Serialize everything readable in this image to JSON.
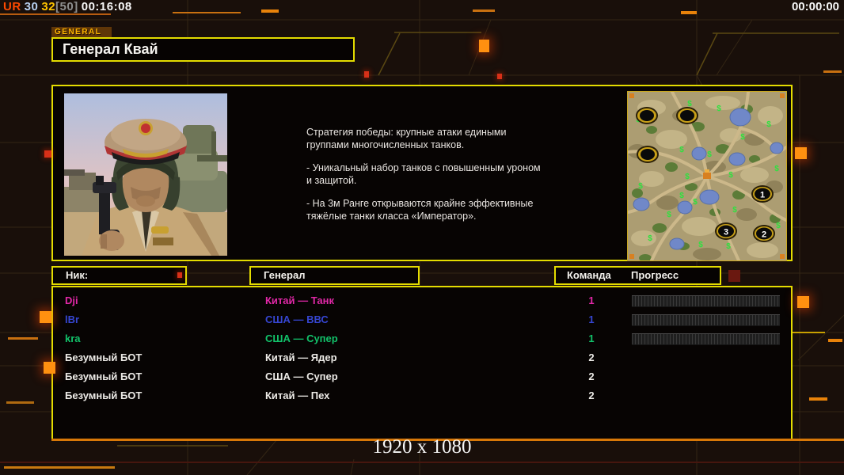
{
  "top_bar": {
    "u": "UR",
    "frame_rate": "30",
    "net_value": "32",
    "net_cap": "[50]",
    "elapsed_time": "00:16:08",
    "countdown_time": "00:00:00"
  },
  "general_tab": {
    "label": "GENERAL"
  },
  "header": {
    "title": "Генерал Квай"
  },
  "description": {
    "l1": "Стратегия победы: крупные атаки едиными",
    "l2": " группами многочисленных танков.",
    "l3": "- Уникальный набор танков с повышенным уроном",
    "l4": " и защитой.",
    "l5": "- На 3м Ранге открываются крайне эффективные",
    "l6": " тяжёлые танки класса «Император»."
  },
  "minimap": {
    "resource_symbol": "$",
    "positions": [
      "1",
      "2",
      "3"
    ]
  },
  "table": {
    "headers": {
      "nick": "Ник:",
      "general": "Генерал",
      "team": "Команда",
      "progress": "Прогресс"
    },
    "rows": [
      {
        "nick": "Dji",
        "general": "Китай — Танк",
        "team": "1",
        "color": "#e228a8",
        "has_progress": true
      },
      {
        "nick": "lBr",
        "general": "США — ВВС",
        "team": "1",
        "color": "#3646d2",
        "has_progress": true
      },
      {
        "nick": "kra",
        "general": "США — Супер",
        "team": "1",
        "color": "#12c26a",
        "has_progress": true
      },
      {
        "nick": "Безумный БОТ",
        "general": "Китай — Ядер",
        "team": "2",
        "color": "#eceae6",
        "has_progress": false
      },
      {
        "nick": "Безумный БОТ",
        "general": "США — Супер",
        "team": "2",
        "color": "#eceae6",
        "has_progress": false
      },
      {
        "nick": "Безумный БОТ",
        "general": "Китай — Пех",
        "team": "2",
        "color": "#eceae6",
        "has_progress": false
      }
    ]
  },
  "footer": {
    "resolution": "1920 x 1080"
  },
  "colors": {
    "accent_yellow": "#e4dc00",
    "accent_orange": "#e8820a",
    "nick_magenta": "#e228a8",
    "nick_blue": "#3646d2",
    "nick_green": "#12c26a"
  }
}
